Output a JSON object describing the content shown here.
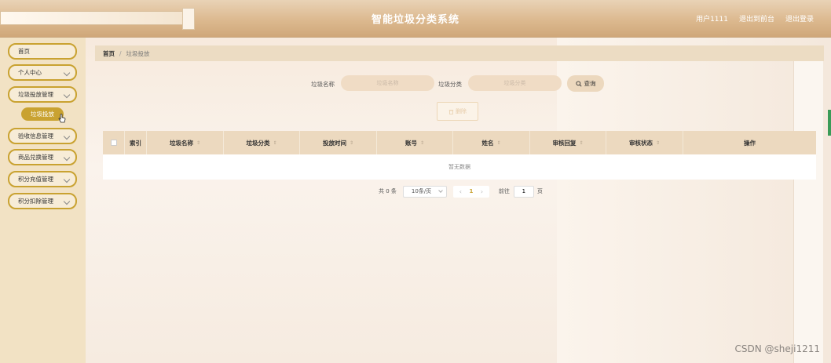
{
  "header": {
    "title": "智能垃圾分类系统",
    "user": "用户1111",
    "back_to_front": "退出到前台",
    "logout": "退出登录"
  },
  "sidebar": {
    "items": [
      {
        "label": "首页",
        "has_arrow": false
      },
      {
        "label": "个人中心",
        "has_arrow": true
      },
      {
        "label": "垃圾投放管理",
        "has_arrow": true
      },
      {
        "label": "验收信息管理",
        "has_arrow": true
      },
      {
        "label": "商品兑换管理",
        "has_arrow": true
      },
      {
        "label": "积分充值管理",
        "has_arrow": true
      },
      {
        "label": "积分扣除管理",
        "has_arrow": true
      }
    ],
    "active_sub": "垃圾投放"
  },
  "breadcrumb": {
    "home": "首页",
    "separator": "/",
    "current": "垃圾投放"
  },
  "search": {
    "name_label": "垃圾名称",
    "name_placeholder": "垃圾名称",
    "category_label": "垃圾分类",
    "category_placeholder": "垃圾分类",
    "query_button": "查询"
  },
  "actions": {
    "delete_button": "删除"
  },
  "table": {
    "columns": [
      "索引",
      "垃圾名称",
      "垃圾分类",
      "投放时间",
      "账号",
      "姓名",
      "审核回复",
      "审核状态",
      "操作"
    ],
    "empty_text": "暂无数据"
  },
  "pagination": {
    "total": "共 0 条",
    "page_size": "10条/页",
    "current_page": "1",
    "goto_label": "前往",
    "goto_value": "1",
    "goto_suffix": "页"
  },
  "watermark": "CSDN @sheji1211",
  "colors": {
    "accent": "#c9a231",
    "header": "#dcb98f",
    "sidebar": "#f2e2c4"
  }
}
